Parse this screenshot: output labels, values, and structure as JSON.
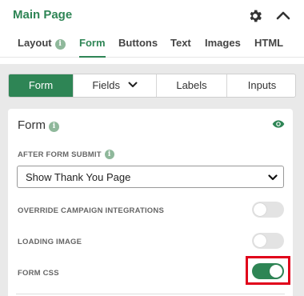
{
  "header": {
    "title": "Main Page",
    "gear_icon": "gear-icon",
    "collapse_icon": "chevron-up-icon"
  },
  "tabs": [
    {
      "label": "Layout",
      "has_info": true
    },
    {
      "label": "Form",
      "active": true
    },
    {
      "label": "Buttons"
    },
    {
      "label": "Text"
    },
    {
      "label": "Images"
    },
    {
      "label": "HTML"
    }
  ],
  "subtabs": [
    {
      "label": "Form",
      "active": true
    },
    {
      "label": "Fields",
      "has_dropdown": true
    },
    {
      "label": "Labels"
    },
    {
      "label": "Inputs"
    }
  ],
  "card": {
    "title": "Form",
    "info_glyph": "i",
    "visibility_icon": "eye-icon",
    "after_submit": {
      "label": "AFTER FORM SUBMIT",
      "selected": "Show Thank You Page"
    },
    "override_integrations": {
      "label": "OVERRIDE CAMPAIGN INTEGRATIONS",
      "enabled": false
    },
    "loading_image": {
      "label": "LOADING IMAGE",
      "enabled": false
    },
    "form_css": {
      "label": "FORM CSS",
      "enabled": true,
      "highlighted": true
    }
  },
  "colors": {
    "accent": "#2e8555",
    "highlight": "#e0001a",
    "panel_bg": "#e9e9e9"
  }
}
